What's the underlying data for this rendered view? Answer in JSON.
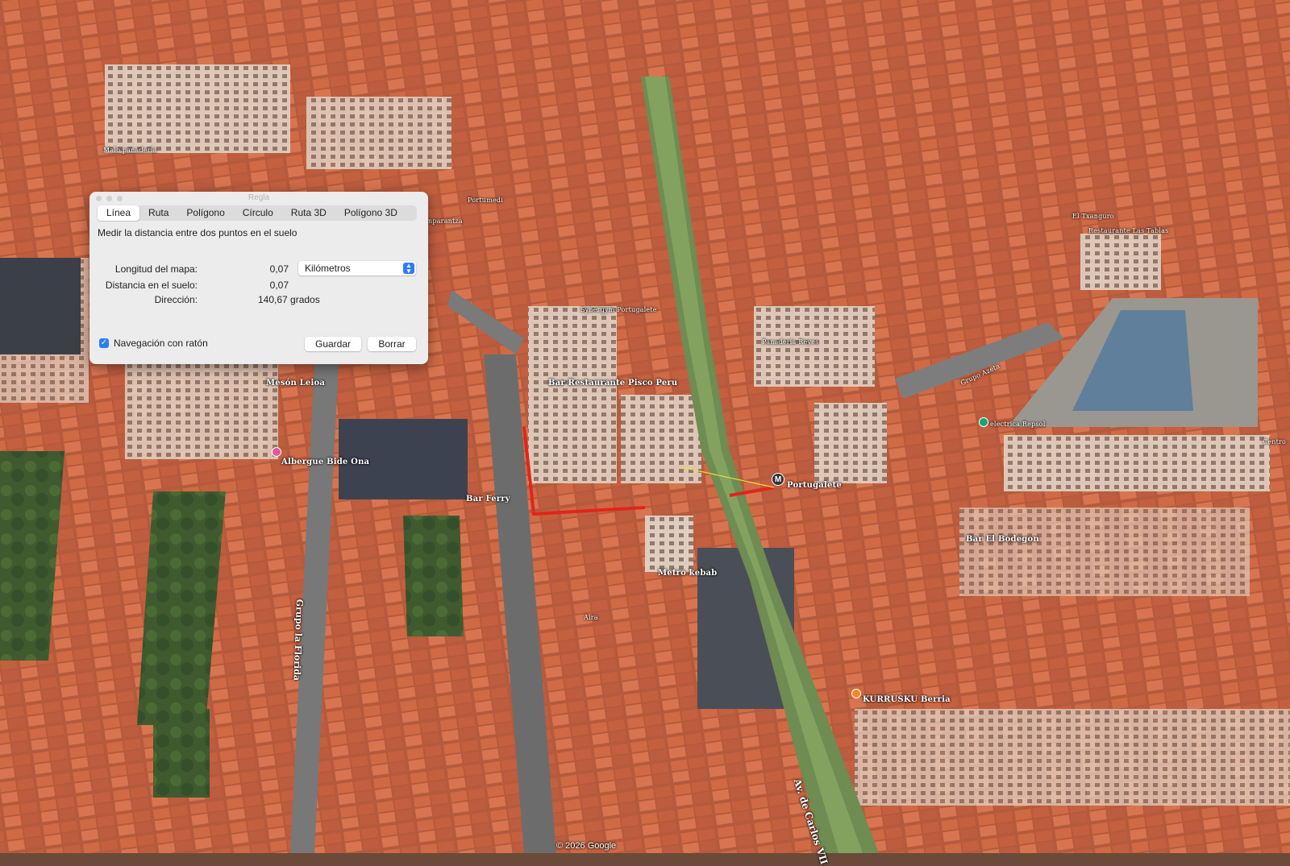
{
  "window": {
    "title": "Regla"
  },
  "tabs": [
    {
      "label": "Línea",
      "selected": true
    },
    {
      "label": "Ruta",
      "selected": false
    },
    {
      "label": "Polígono",
      "selected": false
    },
    {
      "label": "Círculo",
      "selected": false
    },
    {
      "label": "Ruta 3D",
      "selected": false
    },
    {
      "label": "Polígono 3D",
      "selected": false
    }
  ],
  "panel": {
    "description": "Medir la distancia entre dos puntos en el suelo",
    "map_length_label": "Longitud del mapa:",
    "map_length_value": "0,07",
    "unit_selected": "Kilómetros",
    "ground_distance_label": "Distancia en el suelo:",
    "ground_distance_value": "0,07",
    "heading_label": "Dirección:",
    "heading_value": "140,67 grados",
    "mouse_nav_label": "Navegación con ratón",
    "mouse_nav_checked": true,
    "save_label": "Guardar",
    "clear_label": "Borrar"
  },
  "map": {
    "places": {
      "meson_leioa": "Mesón Leioa",
      "albergue": "Albergue Bide Ona",
      "bar_ferry": "Bar Ferry",
      "pisco_peru": "Bar Restaurante Pisco Peru",
      "synergym": "Synergym Portugalete",
      "panaderia": "Panadería Reyes",
      "portugalete": "Portugalete",
      "bodegon": "Bar El Bodegon",
      "metro_kebab": "Metro kebab",
      "aira": "Aira",
      "kurrusku": "KURRUSKU Berria",
      "repsol": "electrica Repsol",
      "restaurante_tablas": "Restaurante Las Tablas",
      "el_txanguro": "El Txanguro",
      "centro": "Centro",
      "enparantza": "Enparantza",
      "portumedi": "Portumedi",
      "malo_panaderia": "Malo panadería"
    },
    "streets": {
      "carlos_vii": "Av. de Carlos VII",
      "grupo_florida": "Grupo la Florida",
      "grupo_azeta": "Grupo Azeta"
    },
    "metro_symbol": "M",
    "copyright": "© 2026 Google"
  }
}
